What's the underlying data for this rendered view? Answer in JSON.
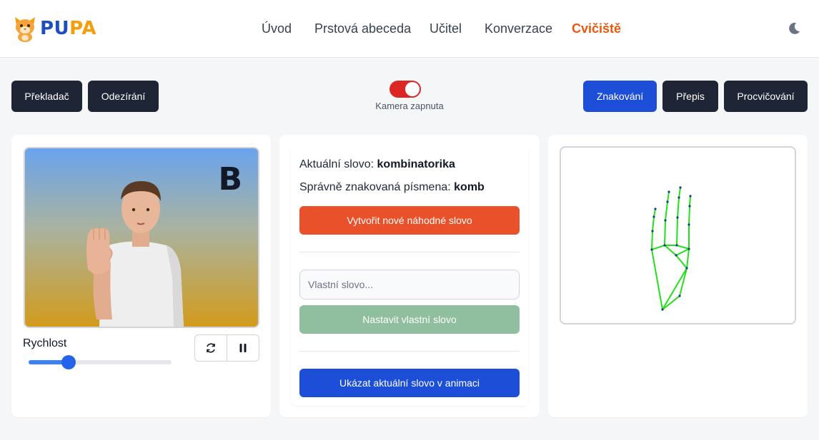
{
  "app": {
    "name_main": "PU",
    "name_accent": "PA"
  },
  "nav": {
    "items": [
      "Úvod",
      "Prstová abeceda",
      "Učitel",
      "Konverzace",
      "Cvičiště"
    ],
    "active": "Cvičiště"
  },
  "toolbar": {
    "left": [
      "Překladač",
      "Odezírání"
    ],
    "camera_label": "Kamera zapnuta",
    "camera_on": true,
    "right": [
      "Znakování",
      "Přepis",
      "Procvičování"
    ],
    "right_active": "Znakování"
  },
  "avatar": {
    "current_letter": "B",
    "speed_label": "Rychlost",
    "speed_value": 0.28
  },
  "practice": {
    "current_word_label": "Aktuální slovo:",
    "current_word": "kombinatorika",
    "signed_label": "Správně znakovaná písmena:",
    "signed_letters": "komb",
    "new_word_button": "Vytvořit nové náhodné slovo",
    "custom_placeholder": "Vlastní slovo...",
    "set_custom_button": "Nastavit vlastní slovo",
    "show_animation_button": "Ukázat aktuální slovo v animaci"
  },
  "colors": {
    "accent_orange": "#ea580c",
    "primary_blue": "#1d4ed8",
    "dark": "#1e2535",
    "red_button": "#e8512a",
    "green_disabled": "#8fbf9f",
    "hand_lines": "#22e01a"
  }
}
